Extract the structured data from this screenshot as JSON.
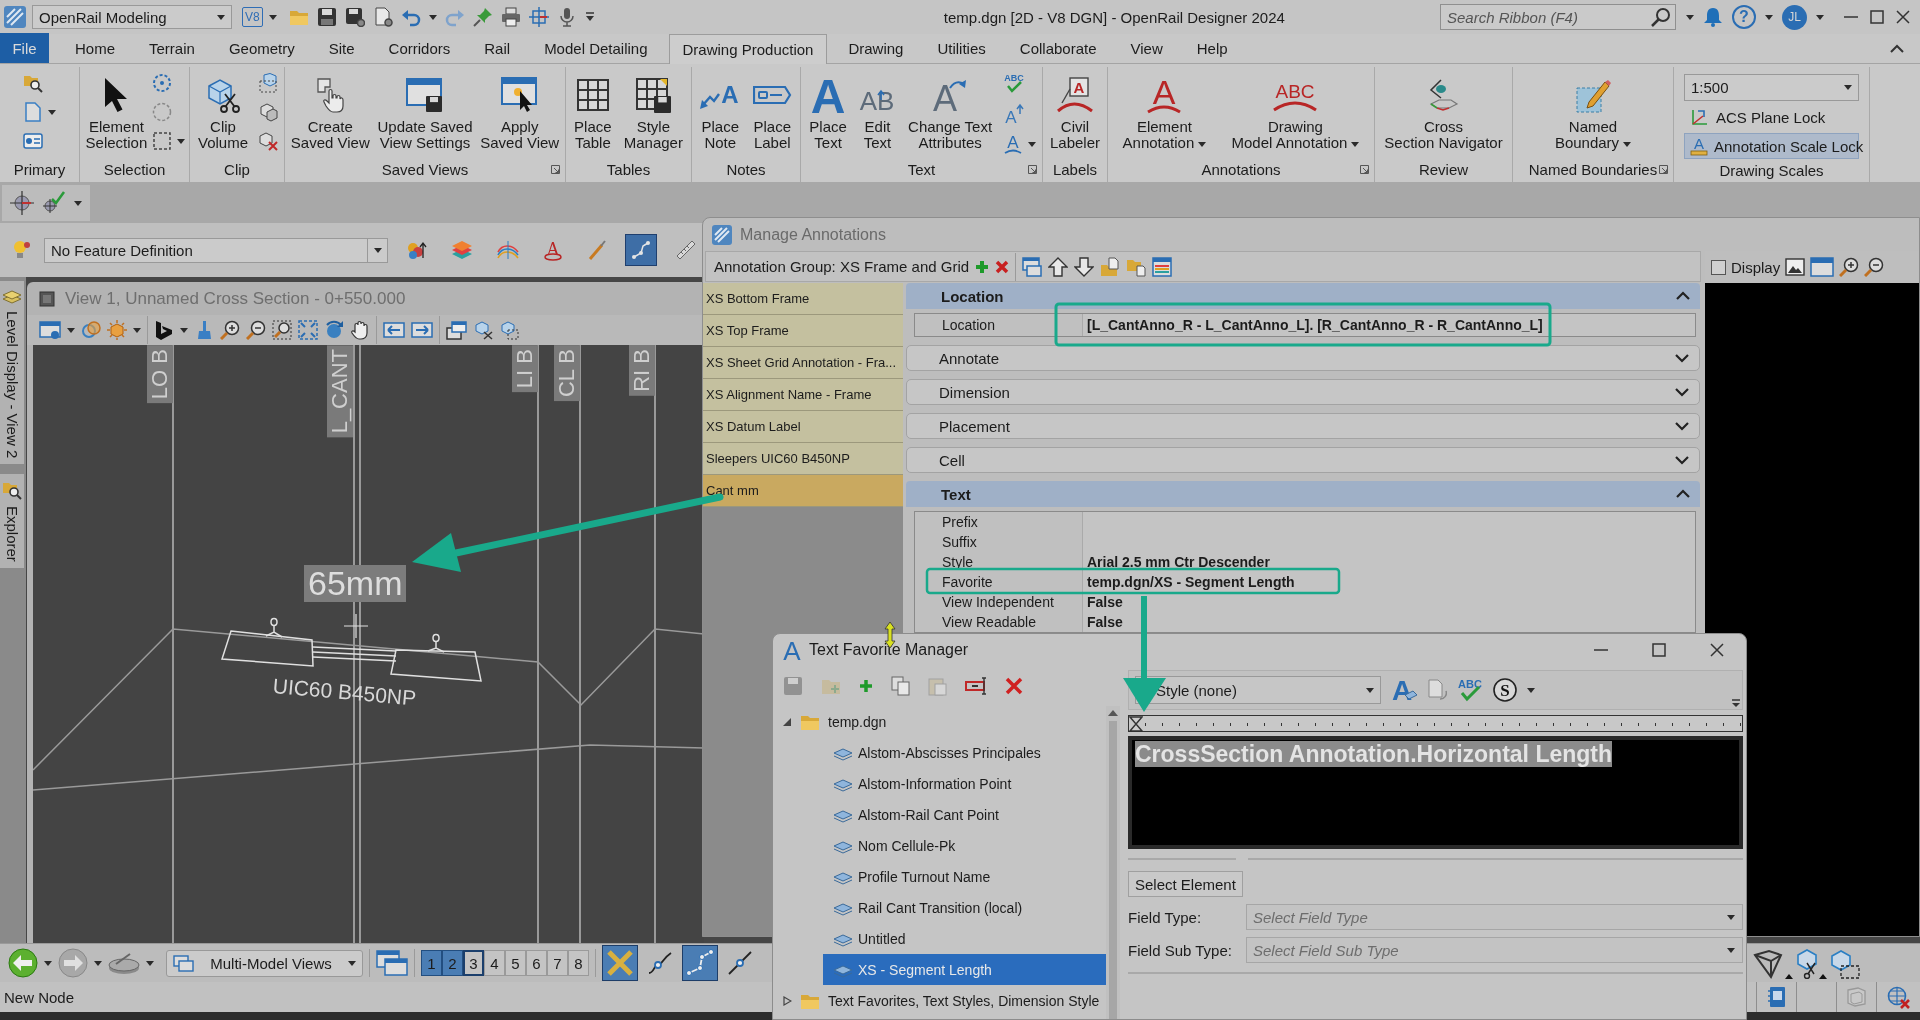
{
  "title_bar": {
    "workflow": "OpenRail Modeling",
    "version_badge": "V8",
    "title": "temp.dgn [2D - V8 DGN] - OpenRail Designer 2024",
    "search": {
      "placeholder": "Search Ribbon (F4)"
    },
    "help": "?",
    "avatar": "JL"
  },
  "ribbon_tabs": [
    {
      "label": "File",
      "kind": "file",
      "selected": false
    },
    {
      "label": "Home",
      "kind": "tab",
      "selected": false
    },
    {
      "label": "Terrain",
      "kind": "tab",
      "selected": false
    },
    {
      "label": "Geometry",
      "kind": "tab",
      "selected": false
    },
    {
      "label": "Site",
      "kind": "tab",
      "selected": false
    },
    {
      "label": "Corridors",
      "kind": "tab",
      "selected": false
    },
    {
      "label": "Rail",
      "kind": "tab",
      "selected": false
    },
    {
      "label": "Model Detailing",
      "kind": "tab",
      "selected": false
    },
    {
      "label": "Drawing Production",
      "kind": "tab",
      "selected": true
    },
    {
      "label": "Drawing",
      "kind": "tab",
      "selected": false
    },
    {
      "label": "Utilities",
      "kind": "tab",
      "selected": false
    },
    {
      "label": "Collaborate",
      "kind": "tab",
      "selected": false
    },
    {
      "label": "View",
      "kind": "tab",
      "selected": false
    },
    {
      "label": "Help",
      "kind": "tab",
      "selected": false
    }
  ],
  "ribbon_groups": [
    {
      "title": "Primary",
      "kind": "buttons",
      "launcher": false
    },
    {
      "title": "Selection",
      "kind": "buttons",
      "launcher": false,
      "buttons": [
        {
          "label": "Element\nSelection",
          "dropdown": false
        }
      ]
    },
    {
      "title": "Clip",
      "kind": "buttons",
      "launcher": false,
      "buttons": [
        {
          "label": "Clip\nVolume",
          "dropdown": false
        }
      ]
    },
    {
      "title": "Saved Views",
      "kind": "buttons",
      "launcher": true,
      "buttons": [
        {
          "label": "Create\nSaved View",
          "dropdown": false
        },
        {
          "label": "Update Saved\nView Settings",
          "dropdown": false
        },
        {
          "label": "Apply\nSaved View",
          "dropdown": false
        }
      ]
    },
    {
      "title": "Tables",
      "kind": "buttons",
      "launcher": false,
      "buttons": [
        {
          "label": "Place\nTable",
          "dropdown": false
        },
        {
          "label": "Style\nManager",
          "dropdown": false
        }
      ]
    },
    {
      "title": "Notes",
      "kind": "buttons",
      "launcher": false,
      "buttons": [
        {
          "label": "Place\nNote",
          "dropdown": false,
          "glyph": "A"
        },
        {
          "label": "Place\nLabel",
          "dropdown": false
        }
      ]
    },
    {
      "title": "Text",
      "kind": "buttons",
      "launcher": true,
      "buttons": [
        {
          "label": "Place\nText",
          "dropdown": false,
          "glyph": "A"
        },
        {
          "label": "Edit\nText",
          "dropdown": false,
          "glyph": "AB"
        },
        {
          "label": "Change Text\nAttributes",
          "dropdown": false,
          "glyph": "A"
        }
      ],
      "small_buttons": [
        {
          "glyph": "ABC",
          "dropdown": false
        },
        {
          "glyph": "A",
          "dropdown": false
        },
        {
          "glyph": "A",
          "dropdown": true
        }
      ]
    },
    {
      "title": "Labels",
      "kind": "buttons",
      "launcher": false,
      "buttons": [
        {
          "label": "Civil\nLabeler",
          "dropdown": false,
          "glyph": "A"
        }
      ]
    },
    {
      "title": "Annotations",
      "kind": "buttons",
      "launcher": true,
      "buttons": [
        {
          "label": "Element\nAnnotation",
          "dropdown": true,
          "glyph": "A"
        },
        {
          "label": "Drawing\nModel Annotation",
          "dropdown": true,
          "glyph": "ABC"
        }
      ]
    },
    {
      "title": "Review",
      "kind": "buttons",
      "launcher": false,
      "buttons": [
        {
          "label": "Cross\nSection Navigator",
          "dropdown": false
        }
      ]
    },
    {
      "title": "Named Boundaries",
      "kind": "buttons",
      "launcher": true,
      "buttons": [
        {
          "label": "Named\nBoundary",
          "dropdown": true
        }
      ]
    },
    {
      "title": "Drawing Scales",
      "kind": "scales",
      "launcher": false,
      "scale": "1:500",
      "toggles": [
        {
          "label": "ACS Plane Lock",
          "on": false
        },
        {
          "label": "Annotation Scale Lock",
          "on": true,
          "glyph": "A"
        }
      ]
    }
  ],
  "feature_toolbar": {
    "feature": "No Feature Definition",
    "tools": [
      {
        "selected": false
      },
      {
        "selected": false
      },
      {
        "selected": false
      },
      {
        "selected": false,
        "glyph": "A"
      },
      {
        "selected": false
      },
      {
        "selected": true
      },
      {
        "selected": false
      }
    ]
  },
  "side_tabs": [
    {
      "label": "Level Display - View 2"
    },
    {
      "label": "Explorer"
    }
  ],
  "view": {
    "title": "View 1, Unnamed Cross Section - 0+550.000",
    "line_labels": [
      "LO B",
      "L_CANT",
      "LI B",
      "CL B",
      "RI B"
    ],
    "annotation": "65mm",
    "sleeper_label": "UIC60 B450NP"
  },
  "manage_annotations": {
    "title": "Manage Annotations",
    "group_label": "Annotation Group: XS Frame and Grid",
    "display": {
      "label": "Display",
      "checked": false
    },
    "items": [
      {
        "label": "XS Bottom Frame",
        "selected": false
      },
      {
        "label": "XS Top Frame",
        "selected": false
      },
      {
        "label": "XS Sheet Grid Annotation - Fra...",
        "selected": false
      },
      {
        "label": "XS Alignment Name - Frame",
        "selected": false
      },
      {
        "label": "XS Datum Label",
        "selected": false
      },
      {
        "label": "Sleepers UIC60 B450NP",
        "selected": false
      },
      {
        "label": "Cant mm",
        "selected": true
      }
    ],
    "sections": [
      {
        "title": "Location",
        "expanded": true,
        "rows": [
          {
            "label": "Location",
            "value": "[L_CantAnno_R - L_CantAnno_L]. [R_CantAnno_R - R_CantAnno_L]"
          }
        ]
      },
      {
        "title": "Annotate",
        "expanded": false
      },
      {
        "title": "Dimension",
        "expanded": false
      },
      {
        "title": "Placement",
        "expanded": false
      },
      {
        "title": "Cell",
        "expanded": false
      },
      {
        "title": "Text",
        "expanded": true,
        "rows": [
          {
            "label": "Prefix"
          },
          {
            "label": "Suffix"
          },
          {
            "label": "Style",
            "value": "Arial 2.5 mm Ctr Descender"
          },
          {
            "label": "Favorite",
            "value": "temp.dgn/XS - Segment Length"
          },
          {
            "label": "View Independent",
            "value": "False"
          },
          {
            "label": "View Readable",
            "value": "False"
          }
        ]
      }
    ]
  },
  "text_favorite_manager": {
    "title": "Text Favorite Manager",
    "icon_glyph": "A",
    "toolbar": [
      {
        "disabled": true
      },
      {
        "disabled": true
      },
      {
        "disabled": false
      },
      {
        "disabled": false
      },
      {
        "disabled": true
      },
      {
        "disabled": false
      },
      {
        "disabled": false
      }
    ],
    "tree": [
      {
        "label": "temp.dgn",
        "expanded": true,
        "selected": false,
        "children": [
          {
            "label": "Alstom-Abscisses Principales",
            "selected": false
          },
          {
            "label": "Alstom-Information Point",
            "selected": false
          },
          {
            "label": "Alstom-Rail Cant Point",
            "selected": false
          },
          {
            "label": "Nom Cellule-Pk",
            "selected": false
          },
          {
            "label": "Profile Turnout Name",
            "selected": false
          },
          {
            "label": "Rail Cant Transition (local)",
            "selected": false
          },
          {
            "label": "Untitled",
            "selected": false
          },
          {
            "label": "XS - Segment Length",
            "selected": true
          }
        ]
      },
      {
        "label": "Text Favorites, Text Styles, Dimension Style",
        "expanded": false,
        "selected": false
      }
    ],
    "style": "Style (none)",
    "format_tools": [
      {
        "glyph": "A"
      },
      {
        "glyph": "ABC"
      },
      {
        "glyph": "S"
      }
    ],
    "preview_text": "CrossSection Annotation.Horizontal Length",
    "select_element": "Select Element",
    "fields": [
      {
        "label": "Field Type:",
        "placeholder": "Select Field Type"
      },
      {
        "label": "Field Sub Type:",
        "placeholder": "Select Field Sub Type"
      }
    ]
  },
  "bottom_toolbar": {
    "view_group": "Multi-Model Views",
    "view_buttons": [
      {
        "label": "1",
        "on": true,
        "selected": false
      },
      {
        "label": "2",
        "on": true,
        "selected": false
      },
      {
        "label": "3",
        "on": false,
        "selected": true
      },
      {
        "label": "4",
        "on": false,
        "selected": false
      },
      {
        "label": "5",
        "on": false,
        "selected": false
      },
      {
        "label": "6",
        "on": false,
        "selected": false
      },
      {
        "label": "7",
        "on": false,
        "selected": false
      },
      {
        "label": "8",
        "on": false,
        "selected": false
      }
    ],
    "tools": [
      {
        "selected": true
      },
      {
        "selected": false
      },
      {
        "selected": true
      },
      {
        "selected": false
      }
    ]
  },
  "status_bar": {
    "message": "New Node"
  }
}
